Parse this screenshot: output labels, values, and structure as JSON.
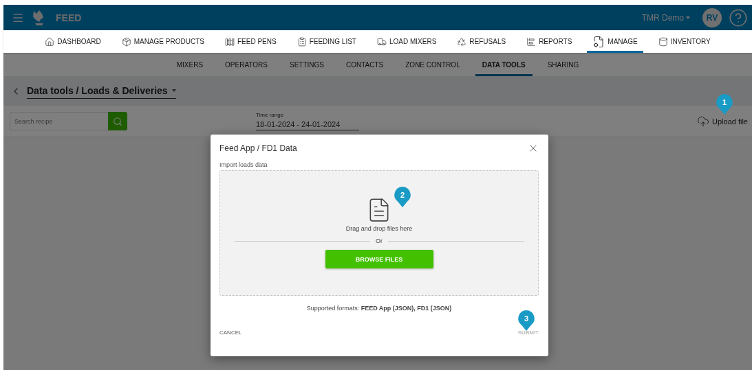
{
  "app_bar": {
    "title": "FEED",
    "account": "TMR Demo",
    "avatar": "RV"
  },
  "main_nav": [
    {
      "label": "DASHBOARD",
      "selected": false
    },
    {
      "label": "MANAGE PRODUCTS",
      "selected": false
    },
    {
      "label": "FEED PENS",
      "selected": false
    },
    {
      "label": "FEEDING LIST",
      "selected": false
    },
    {
      "label": "LOAD MIXERS",
      "selected": false
    },
    {
      "label": "REFUSALS",
      "selected": false
    },
    {
      "label": "REPORTS",
      "selected": false
    },
    {
      "label": "MANAGE",
      "selected": true
    },
    {
      "label": "INVENTORY",
      "selected": false
    }
  ],
  "sub_nav": [
    {
      "label": "MIXERS",
      "selected": false
    },
    {
      "label": "OPERATORS",
      "selected": false
    },
    {
      "label": "SETTINGS",
      "selected": false
    },
    {
      "label": "CONTACTS",
      "selected": false
    },
    {
      "label": "ZONE CONTROL",
      "selected": false
    },
    {
      "label": "DATA TOOLS",
      "selected": true
    },
    {
      "label": "SHARING",
      "selected": false
    }
  ],
  "breadcrumb": "Data tools / Loads & Deliveries",
  "filters": {
    "search": {
      "placeholder": "Search recipe"
    },
    "time_range": {
      "label": "Time range",
      "value": "18-01-2024 - 24-01-2024"
    },
    "upload": "Upload file"
  },
  "dialog": {
    "title": "Feed App / FD1 Data",
    "section_label": "Import loads data",
    "drop_text": "Drag and drop files here",
    "separator": "Or",
    "browse": "BROWSE FILES",
    "formats": "Supported formats: **FEED App (JSON), FD1 (JSON)**",
    "cancel": "CANCEL",
    "submit": {
      "label": "SUBMIT",
      "disabled": true
    }
  },
  "markers": [
    "1",
    "2",
    "3"
  ]
}
